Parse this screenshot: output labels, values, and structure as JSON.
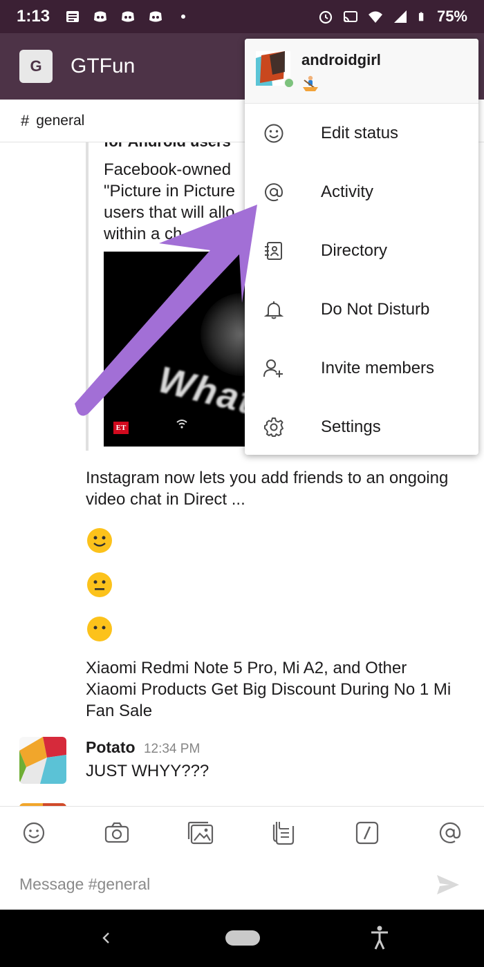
{
  "status_bar": {
    "time": "1:13",
    "battery": "75%"
  },
  "header": {
    "workspace_initial": "G",
    "workspace_name": "GTFun"
  },
  "channel": {
    "hash": "#",
    "name": "general"
  },
  "messages": {
    "attachment": {
      "cut_title": "for Android users",
      "description_lines": [
        "Facebook-owned",
        "\"Picture in Picture",
        "users that will allo",
        "within a ch"
      ],
      "preview_text": "What",
      "source_badge": "ET"
    },
    "instagram_text": "Instagram now lets you add friends to an ongoing video chat in Direct ...",
    "emojis": [
      "slightly-smiling-face",
      "neutral-face",
      "face-without-mouth"
    ],
    "xiaomi_text": "Xiaomi Redmi Note 5 Pro, Mi A2, and Other Xiaomi Products Get Big Discount During No 1 Mi Fan Sale",
    "last_message": {
      "sender": "Potato",
      "time": "12:34 PM",
      "text": "JUST WHYY???"
    }
  },
  "composer": {
    "placeholder": "Message #general",
    "toolbar_icons": [
      "emoji-icon",
      "camera-icon",
      "gallery-icon",
      "files-icon",
      "slash-command-icon",
      "mention-icon"
    ]
  },
  "dropdown": {
    "username": "androidgirl",
    "status_emoji": "person-rowing-boat",
    "items": [
      {
        "label": "Edit status",
        "icon": "smiley-icon"
      },
      {
        "label": "Activity",
        "icon": "at-icon"
      },
      {
        "label": "Directory",
        "icon": "directory-icon"
      },
      {
        "label": "Do Not Disturb",
        "icon": "bell-icon"
      },
      {
        "label": "Invite members",
        "icon": "add-person-icon"
      },
      {
        "label": "Settings",
        "icon": "gear-icon"
      }
    ]
  },
  "colors": {
    "status_bar": "#3b2034",
    "header": "#4d3347",
    "annotation_arrow": "#a26fd6",
    "presence": "#7dc27d"
  }
}
